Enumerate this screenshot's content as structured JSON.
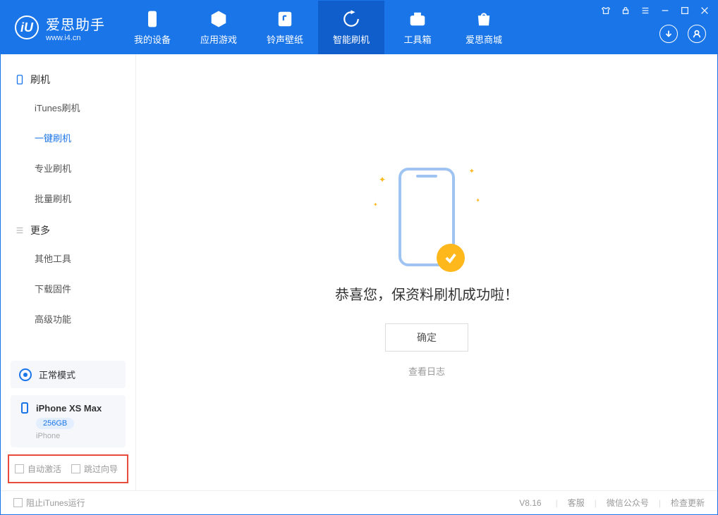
{
  "app": {
    "title": "爱思助手",
    "subtitle": "www.i4.cn"
  },
  "nav": {
    "device": "我的设备",
    "apps": "应用游戏",
    "ringtone": "铃声壁纸",
    "flash": "智能刷机",
    "toolbox": "工具箱",
    "store": "爱思商城"
  },
  "sidebar": {
    "section1": {
      "title": "刷机",
      "items": [
        "iTunes刷机",
        "一键刷机",
        "专业刷机",
        "批量刷机"
      ]
    },
    "section2": {
      "title": "更多",
      "items": [
        "其他工具",
        "下载固件",
        "高级功能"
      ]
    },
    "mode": "正常模式",
    "device": {
      "name": "iPhone XS Max",
      "storage": "256GB",
      "type": "iPhone"
    },
    "checks": {
      "auto_activate": "自动激活",
      "skip_wizard": "跳过向导"
    }
  },
  "main": {
    "success_title": "恭喜您，保资料刷机成功啦！",
    "ok_button": "确定",
    "view_log": "查看日志"
  },
  "status": {
    "block_itunes": "阻止iTunes运行",
    "version": "V8.16",
    "support": "客服",
    "wechat": "微信公众号",
    "update": "检查更新"
  }
}
